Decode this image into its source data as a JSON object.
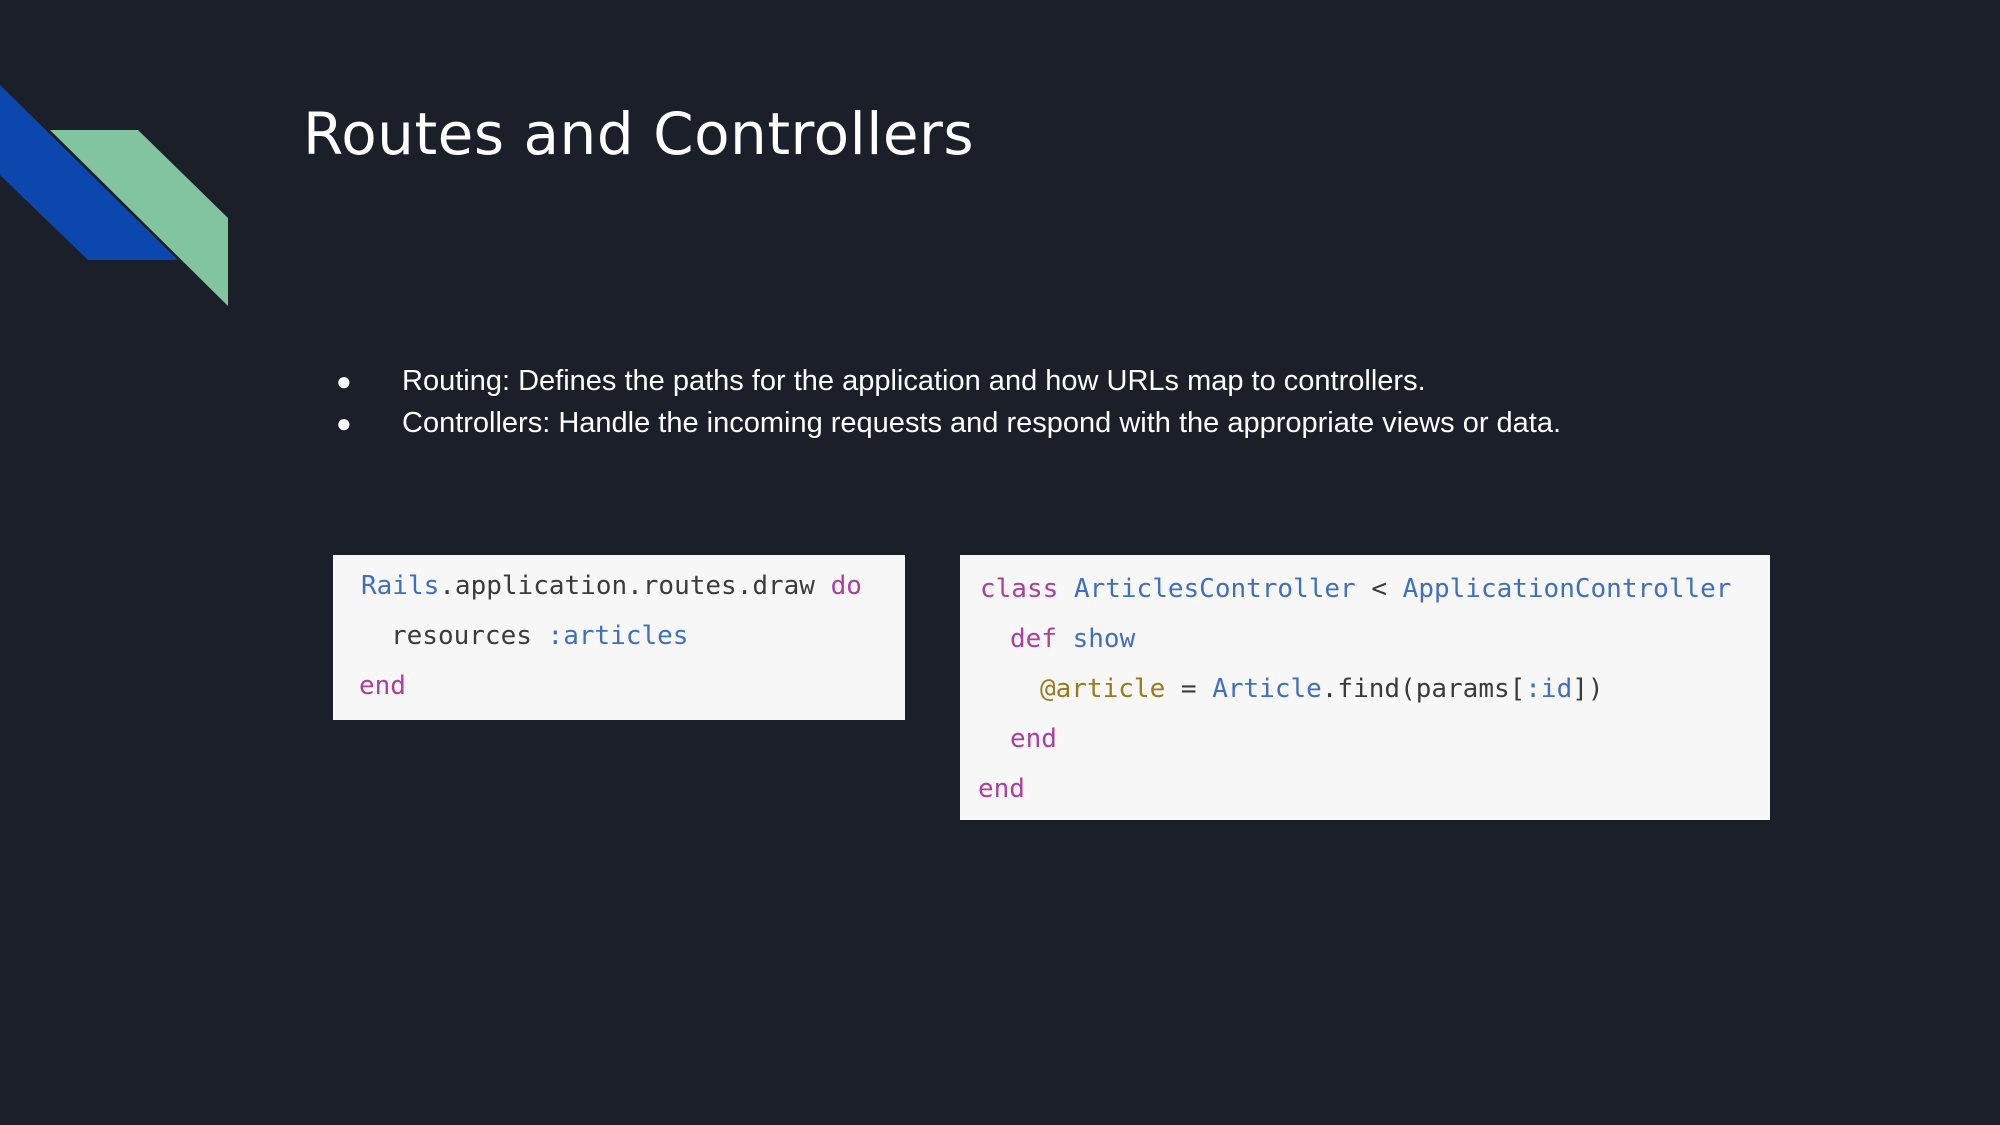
{
  "slide": {
    "title": "Routes and Controllers",
    "bullets": [
      "Routing: Defines the paths for the application and how URLs map to controllers.",
      "Controllers: Handle the incoming requests and respond with the appropriate views or data."
    ],
    "bullet_marker": "●"
  },
  "colors": {
    "background": "#1b1f2a",
    "accent_blue": "#0b47ad",
    "accent_green": "#82c49e",
    "code_keyword": "#b03d9c",
    "code_constant": "#3f6fc4",
    "code_ivar": "#9a7a1c",
    "code_text": "#3b3b3b"
  },
  "routes_code": {
    "l1_const": "Rails",
    "l1_text": ".application.routes.draw ",
    "l1_kw": "do",
    "l2_text": "resources ",
    "l2_sym": ":articles",
    "l3_kw": "end"
  },
  "controller_code": {
    "l1_kw": "class",
    "l1_const1": "ArticlesController",
    "l1_op": " < ",
    "l1_const2": "ApplicationController",
    "l2_kw": "def",
    "l2_name": "show",
    "l3_ivar": "@article",
    "l3_op": " = ",
    "l3_const": "Article",
    "l3_text1": ".find(params[",
    "l3_sym": ":id",
    "l3_text2": "])",
    "l4_kw": "end",
    "l5_kw": "end"
  }
}
